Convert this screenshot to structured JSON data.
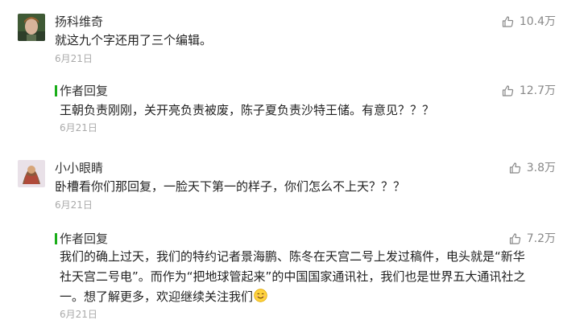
{
  "comments": [
    {
      "nickname": "扬科维奇",
      "content": "就这九个字还用了三个编辑。",
      "date": "6月21日",
      "likes": "10.4万",
      "reply": {
        "author_label": "作者回复",
        "lines": [
          "王朝负责刚刚，关开亮负责被废，陈子夏负责沙特王储。有意见？？？"
        ],
        "date": "6月21日",
        "likes": "12.7万"
      }
    },
    {
      "nickname": "小小眼睛",
      "content": "卧槽看你们那回复，一脸天下第一的样子，你们怎么不上天？？？",
      "date": "6月21日",
      "likes": "3.8万",
      "reply": {
        "author_label": "作者回复",
        "lines": [
          "我们的确上过天，我们的特约记者景海鹏、陈冬在天宫二号上发过稿件，电头就是“新华",
          "社天宫二号电”。而作为“把地球管起来”的中国国家通讯社，我们也是世界五大通讯社之",
          "一。想了解更多，欢迎继续关注我们"
        ],
        "date": "6月21日",
        "likes": "7.2万"
      }
    }
  ],
  "icons": {
    "like": "thumbs-up-icon",
    "emoji": "smiling-face-emoji"
  },
  "colors": {
    "reply_accent": "#1aad19",
    "date": "#aaaaaa",
    "like": "#888888"
  }
}
